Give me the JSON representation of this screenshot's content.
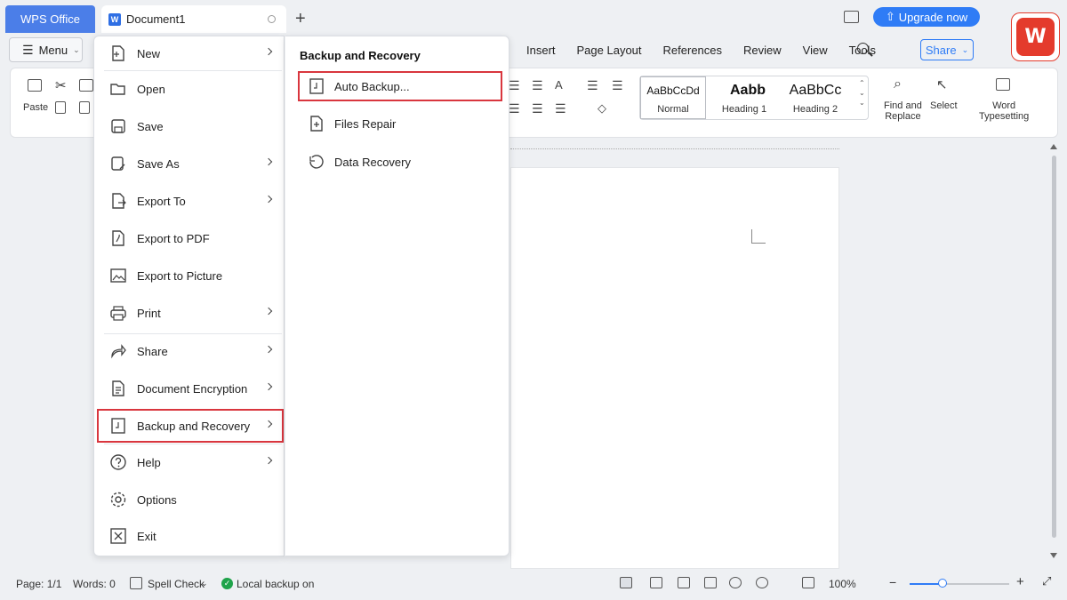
{
  "titlebar": {
    "wps_tab": "WPS Office",
    "doc_tab": "Document1",
    "upgrade": "Upgrade now"
  },
  "toolbar": {
    "menu_label": "Menu",
    "tabs": [
      "Insert",
      "Page Layout",
      "References",
      "Review",
      "View",
      "Tools"
    ],
    "share_label": "Share"
  },
  "ribbon": {
    "paste": "Paste",
    "styles": [
      {
        "sample": "AaBbCcDd",
        "name": "Normal"
      },
      {
        "sample": "Aabb",
        "name": "Heading 1"
      },
      {
        "sample": "AaBbCc",
        "name": "Heading 2"
      }
    ],
    "find_replace_1": "Find and",
    "find_replace_2": "Replace",
    "select": "Select",
    "word_typesetting_1": "Word",
    "word_typesetting_2": "Typesetting"
  },
  "menu": {
    "items": [
      {
        "label": "New",
        "icon": "new-doc-icon",
        "submenu": true
      },
      {
        "label": "Open",
        "icon": "folder-open-icon",
        "submenu": false
      },
      {
        "label": "Save",
        "icon": "save-icon",
        "submenu": false
      },
      {
        "label": "Save As",
        "icon": "save-as-icon",
        "submenu": true
      },
      {
        "label": "Export To",
        "icon": "export-icon",
        "submenu": true
      },
      {
        "label": "Export to PDF",
        "icon": "pdf-icon",
        "submenu": false
      },
      {
        "label": "Export to Picture",
        "icon": "picture-icon",
        "submenu": false
      },
      {
        "label": "Print",
        "icon": "printer-icon",
        "submenu": true
      },
      {
        "label": "Share",
        "icon": "share-icon",
        "submenu": true
      },
      {
        "label": "Document Encryption",
        "icon": "encryption-icon",
        "submenu": true
      },
      {
        "label": "Backup and Recovery",
        "icon": "backup-icon",
        "submenu": true
      },
      {
        "label": "Help",
        "icon": "help-icon",
        "submenu": true
      },
      {
        "label": "Options",
        "icon": "gear-icon",
        "submenu": false
      },
      {
        "label": "Exit",
        "icon": "close-icon",
        "submenu": false
      }
    ]
  },
  "submenu": {
    "title": "Backup and Recovery",
    "items": [
      {
        "label": "Auto Backup...",
        "icon": "auto-backup-icon"
      },
      {
        "label": "Files Repair",
        "icon": "files-repair-icon"
      },
      {
        "label": "Data Recovery",
        "icon": "data-recovery-icon"
      }
    ]
  },
  "status": {
    "page": "Page: 1/1",
    "words": "Words: 0",
    "spell_check": "Spell Check",
    "backup": "Local backup on",
    "zoom": "100%"
  },
  "colors": {
    "accent": "#2f7cf6",
    "highlight": "#d9363e",
    "wps_tab": "#4b7ee8",
    "logo": "#e43b2c"
  }
}
